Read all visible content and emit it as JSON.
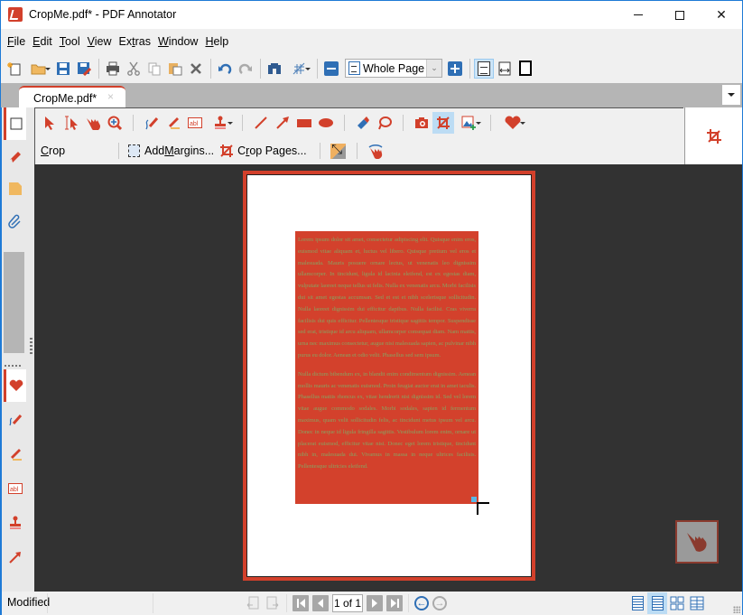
{
  "window": {
    "title": "CropMe.pdf* - PDF Annotator",
    "controls": {
      "minimize": "minimize",
      "maximize": "maximize",
      "close": "close"
    }
  },
  "menu": [
    {
      "label": "File",
      "accel": "F",
      "rest": "ile"
    },
    {
      "label": "Edit",
      "accel": "E",
      "rest": "dit"
    },
    {
      "label": "Tool",
      "accel": "T",
      "rest": "ool"
    },
    {
      "label": "View",
      "accel": "V",
      "rest": "iew"
    },
    {
      "label": "Extras",
      "pre": "Ex",
      "accel": "t",
      "rest": "ras"
    },
    {
      "label": "Window",
      "accel": "W",
      "rest": "indow"
    },
    {
      "label": "Help",
      "accel": "H",
      "rest": "elp"
    }
  ],
  "toolbar": {
    "buttons": [
      "new-icon",
      "open-icon",
      "save-icon",
      "save-as-icon",
      "print-icon",
      "cut-icon",
      "copy-icon",
      "paste-icon",
      "delete-icon",
      "undo-icon",
      "redo-icon",
      "find-icon",
      "grid-icon"
    ],
    "zoom_select": {
      "value": "Whole Page"
    },
    "view_modes": [
      "single-page-icon",
      "fit-width-icon",
      "fullscreen-icon"
    ]
  },
  "tabs": [
    {
      "label": "CropMe.pdf*",
      "close": "×",
      "active": true
    }
  ],
  "sidebar": {
    "top_tabs": [
      "page-icon",
      "bookmark-icon",
      "note-icon",
      "attachment-icon"
    ],
    "bottom_tabs": [
      "heart-icon",
      "pen-icon",
      "highlighter-icon",
      "textbox-icon",
      "stamp-icon",
      "arrow-icon"
    ]
  },
  "ribbon": {
    "row1_tools": [
      "select-icon",
      "text-select-icon",
      "hand-icon",
      "zoom-icon",
      "pen-icon",
      "highlighter-icon",
      "textbox-icon",
      "stamp-icon",
      "line-icon",
      "arrow-icon",
      "rectangle-icon",
      "ellipse-icon",
      "eraser-icon",
      "lasso-icon",
      "camera-icon",
      "crop-icon",
      "insert-image-icon",
      "favorites-icon"
    ],
    "active_tool": "crop-icon",
    "crop_label": {
      "pre": "",
      "accel": "C",
      "rest": "rop"
    },
    "add_margins": {
      "pre": "Add ",
      "accel": "M",
      "rest": "argins..."
    },
    "crop_pages": {
      "pre": "C",
      "accel": "r",
      "rest": "op Pages..."
    }
  },
  "document": {
    "paragraphs": [
      "Lorem ipsum dolor sit amet, consectetur adipiscing elit. Quisque enim eros, euismod vitae aliquam et, luctus vel libero. Quisque pretium vel eros et malesuada. Mauris posuere ornare lectus, ut venenatis leo dignissim ullamcorper. In tincidunt, ligula id lacinia eleifend, est ex egestas diam, vulputate laoreet neque tellus ut felis. Nulla ex venenatis arcu. Morbi facilisis dui sit amet egestas accumsan. Sed et est et nibh scelerisque sollicitudin. Nulla laoreet dignissim dui efficitur dapibus. Nulla facilisi. Cras viverra facilisis dui quis efficitur. Pellentesque tristique sagittis tempor. Suspendisse sed erat, tristique id arcu aliquam, ullamcorper consequat diam. Nam mattis, urna nec maximus consectetur, augue nisi malesuada sapien, ac pulvinar nibh purus eu dolor. Aenean et odio velit. Phasellus sed sem ipsum.",
      "Nulla dictum bibendum ex, in blandit enim condimentum dignissim. Aenean mollis mauris ac venenatis euismod. Proin feugiat auctor erat in amet iaculis. Phasellus mattis rhoncus ex, vitae hendrerit nisi dignissim id. Sed vel lorem vitae augue commodo sodales. Morbi sodales, sapien id fermentum maximus, quam velit sollicitudin felis, ac tincidunt metus ipsum vel arcu. Donec in neque id ligula fringilla sagittis. Vestibulum lorem enim, ornare ut placerat euismod, efficitur vitae nisi. Donec eget lorem tristique, tincidunt nibh in, malesuada dui. Vivamus in massa in neque ultrices facilisis. Pellentesque ultricies eleifend."
    ],
    "floating_tool": "hand-icon"
  },
  "status": {
    "text": "Modified",
    "page_display": "1 of 1",
    "view_modes": [
      "single-page",
      "continuous",
      "two-page",
      "two-page-continuous"
    ],
    "active_view": "continuous"
  },
  "colors": {
    "accent": "#d2402b",
    "doc_bg": "#323232",
    "selection_blue": "#bcdcf4",
    "title_border": "#1e7ad6"
  }
}
